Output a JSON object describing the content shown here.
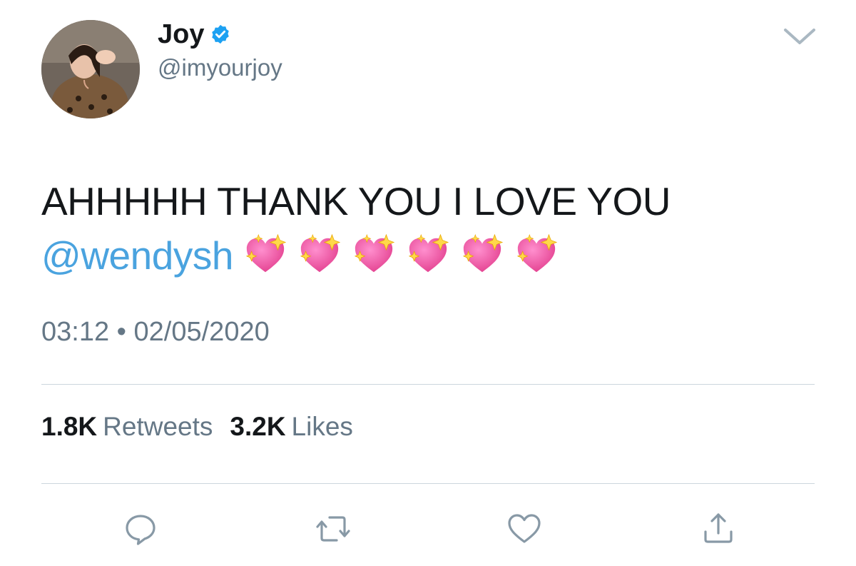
{
  "tweet": {
    "author": {
      "display_name": "Joy",
      "handle": "@imyourjoy",
      "verified": true,
      "avatar_icon": "avatar-photo"
    },
    "text_line1": "AHHHHH THANK YOU I LOVE YOU",
    "mention": "@wendysh",
    "emojis": [
      "sparkling-heart",
      "sparkling-heart",
      "sparkling-heart",
      "sparkling-heart",
      "sparkling-heart",
      "sparkling-heart"
    ],
    "time": "03:12",
    "separator": "•",
    "date": "02/05/2020",
    "retweets": {
      "count": "1.8K",
      "label": "Retweets"
    },
    "likes": {
      "count": "3.2K",
      "label": "Likes"
    }
  },
  "actions": [
    "reply-icon",
    "retweet-icon",
    "like-icon",
    "share-icon"
  ],
  "colors": {
    "text": "#14171a",
    "secondary": "#657786",
    "link": "#4aa3df",
    "verified": "#1da1f2",
    "divider": "#ccd6dd",
    "heart": "#e3408f"
  }
}
